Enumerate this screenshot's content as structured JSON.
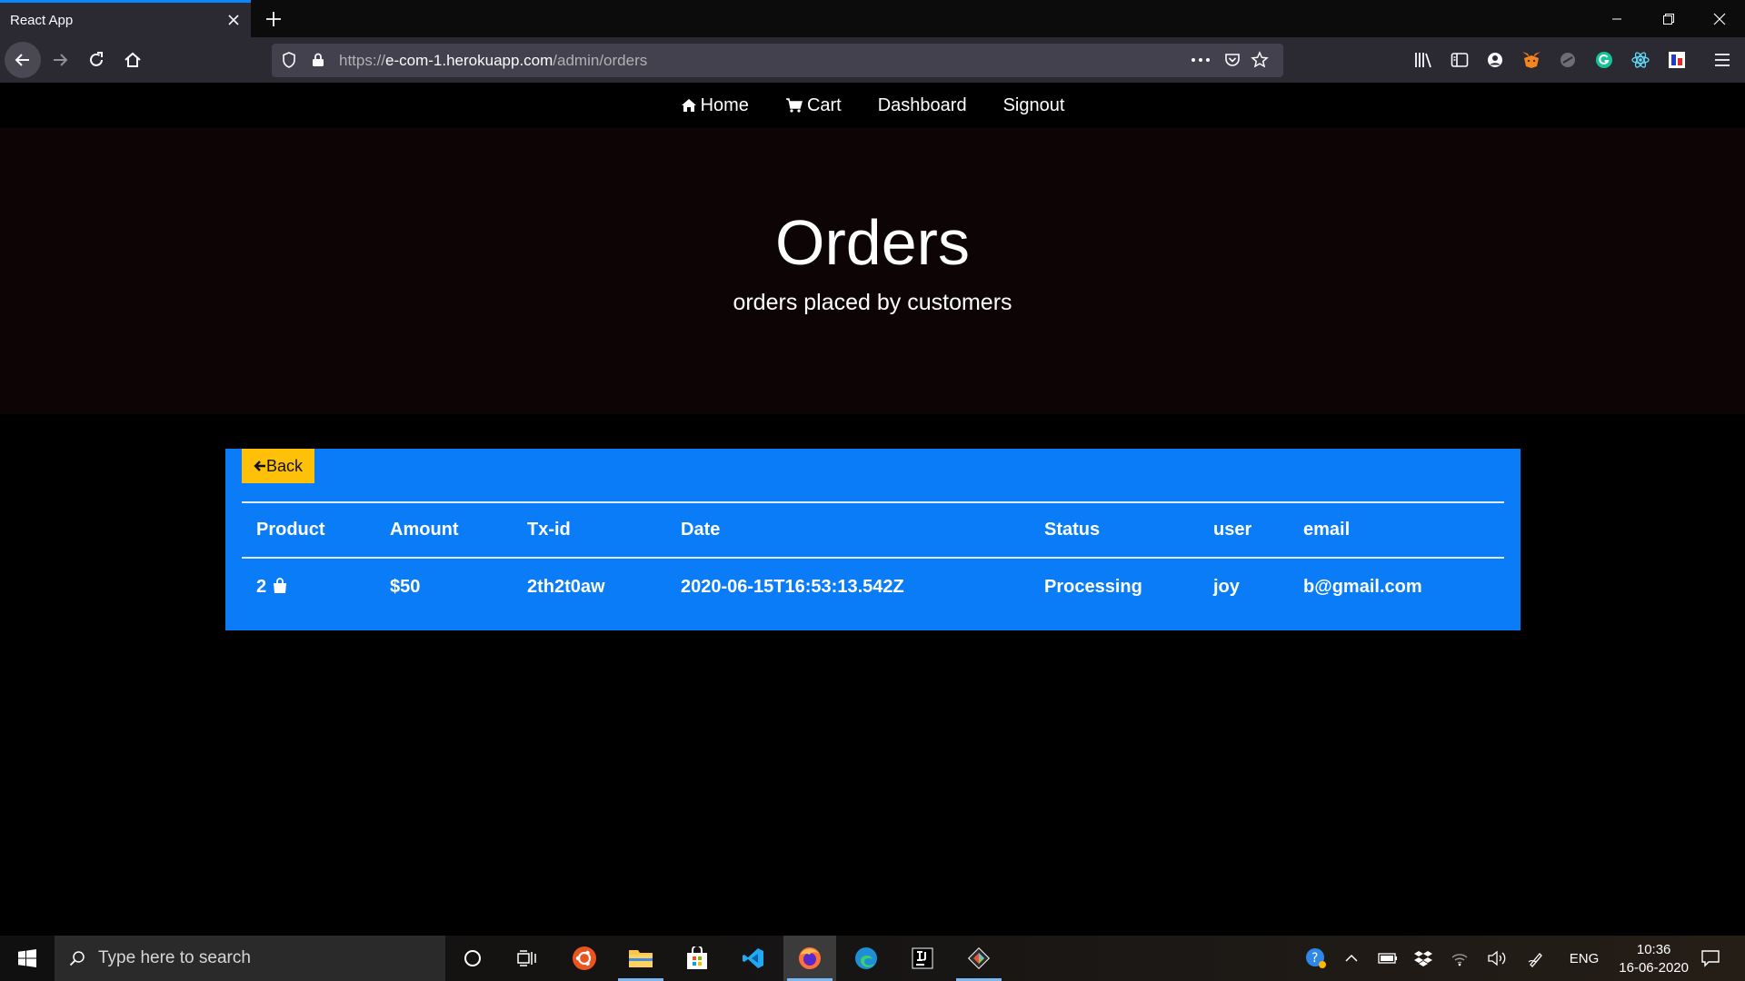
{
  "browser": {
    "tab_title": "React App",
    "url_scheme": "https://",
    "url_host": "e-com-1.herokuapp.com",
    "url_path": "/admin/orders"
  },
  "site_nav": {
    "home": "Home",
    "cart": "Cart",
    "dashboard": "Dashboard",
    "signout": "Signout"
  },
  "hero": {
    "title": "Orders",
    "subtitle": "orders placed by customers"
  },
  "panel": {
    "back_label": "Back",
    "columns": [
      "Product",
      "Amount",
      "Tx-id",
      "Date",
      "Status",
      "user",
      "email"
    ],
    "rows": [
      {
        "product": "2",
        "amount": "$50",
        "txid": "2th2t0aw",
        "date": "2020-06-15T16:53:13.542Z",
        "status": "Processing",
        "user": "joy",
        "email": "b@gmail.com"
      }
    ]
  },
  "taskbar": {
    "search_placeholder": "Type here to search",
    "language": "ENG",
    "time": "10:36",
    "date": "16-06-2020"
  },
  "colors": {
    "panel_blue": "#0a7cf8",
    "back_button": "#ffc107",
    "hero_bg": "#0d0405"
  }
}
